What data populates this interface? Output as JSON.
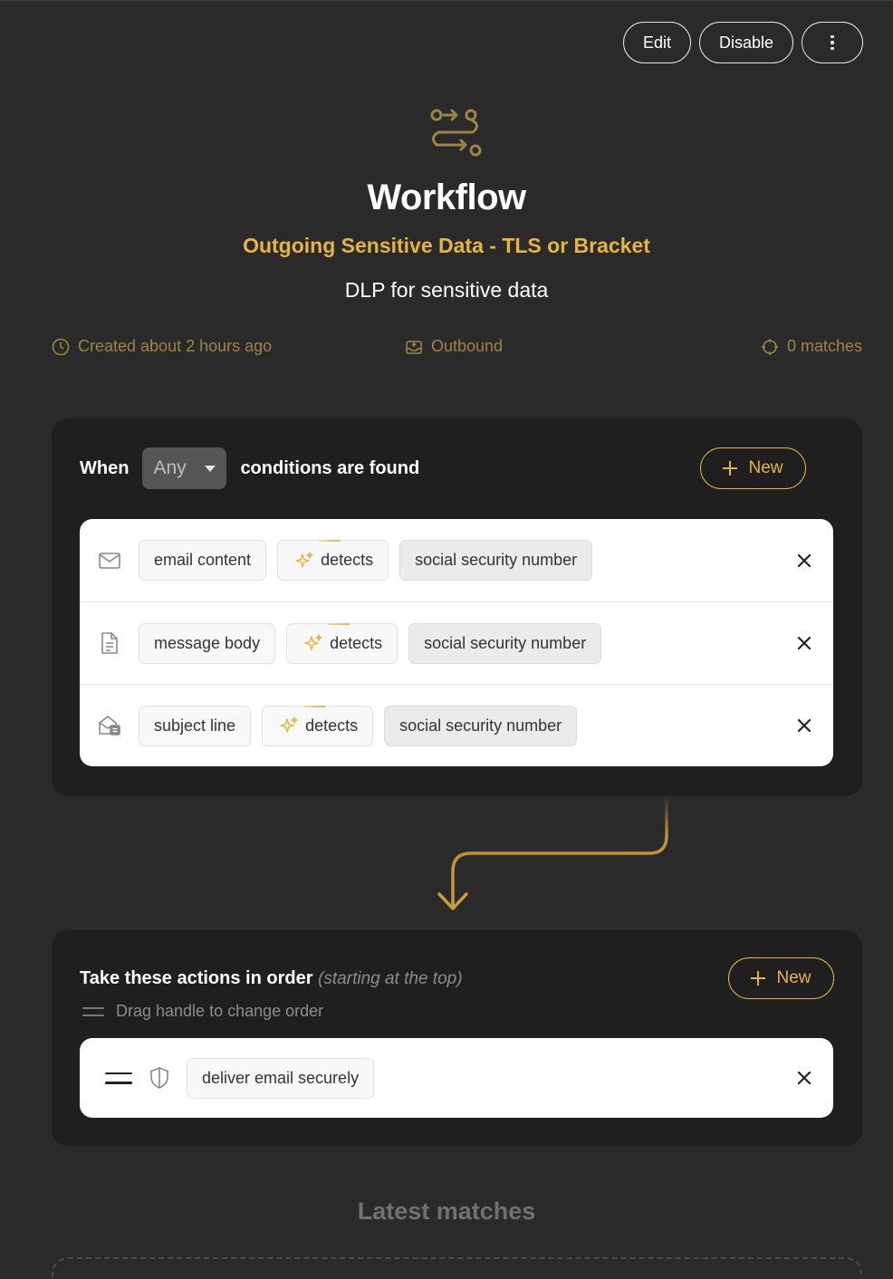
{
  "header": {
    "edit_label": "Edit",
    "disable_label": "Disable"
  },
  "hero": {
    "title": "Workflow",
    "subtitle": "Outgoing Sensitive Data - TLS or Bracket",
    "description": "DLP for sensitive data"
  },
  "meta": {
    "created": "Created about 2 hours ago",
    "direction": "Outbound",
    "matches": "0 matches"
  },
  "conditions": {
    "when_label": "When",
    "mode": "Any",
    "suffix": "conditions are found",
    "new_label": "New",
    "rows": [
      {
        "icon": "mail-icon",
        "field": "email content",
        "operator": "detects",
        "value": "social security number"
      },
      {
        "icon": "document-icon",
        "field": "message body",
        "operator": "detects",
        "value": "social security number"
      },
      {
        "icon": "subject-mail-icon",
        "field": "subject line",
        "operator": "detects",
        "value": "social security number"
      }
    ]
  },
  "actions": {
    "title": "Take these actions in order",
    "hint": "(starting at the top)",
    "drag_hint": "Drag handle to change order",
    "new_label": "New",
    "items": [
      {
        "icon": "shield-icon",
        "label": "deliver email securely"
      }
    ]
  },
  "latest_matches": {
    "title": "Latest matches"
  },
  "colors": {
    "accent": "#e8b53a",
    "muted_accent": "#9c8442",
    "background": "#2a2a2a",
    "panel": "#1f1f1f"
  }
}
